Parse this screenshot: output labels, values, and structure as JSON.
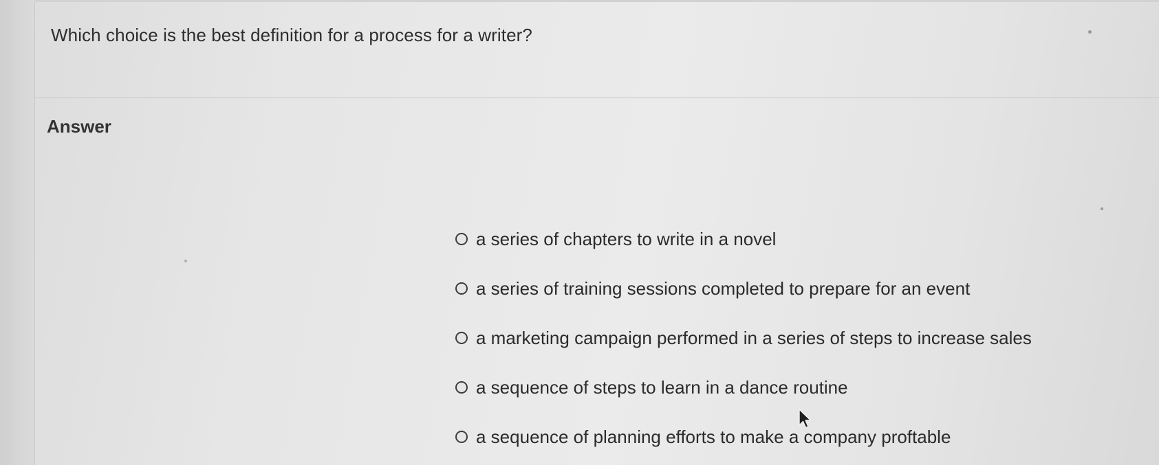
{
  "question": {
    "text": "Which choice is the best definition for a process for a writer?"
  },
  "answer_section": {
    "heading": "Answer",
    "options": [
      {
        "label": "a series of chapters to write in a novel",
        "selected": false
      },
      {
        "label": "a series of training sessions completed to prepare for an event",
        "selected": false
      },
      {
        "label": "a marketing campaign performed in a series of steps to increase sales",
        "selected": false
      },
      {
        "label": "a sequence of steps to learn in a dance routine",
        "selected": false
      },
      {
        "label": "a sequence of planning efforts to make a company proftable",
        "selected": false
      }
    ]
  },
  "icons": {
    "radio": "radio-button-icon",
    "cursor": "mouse-pointer-icon"
  }
}
